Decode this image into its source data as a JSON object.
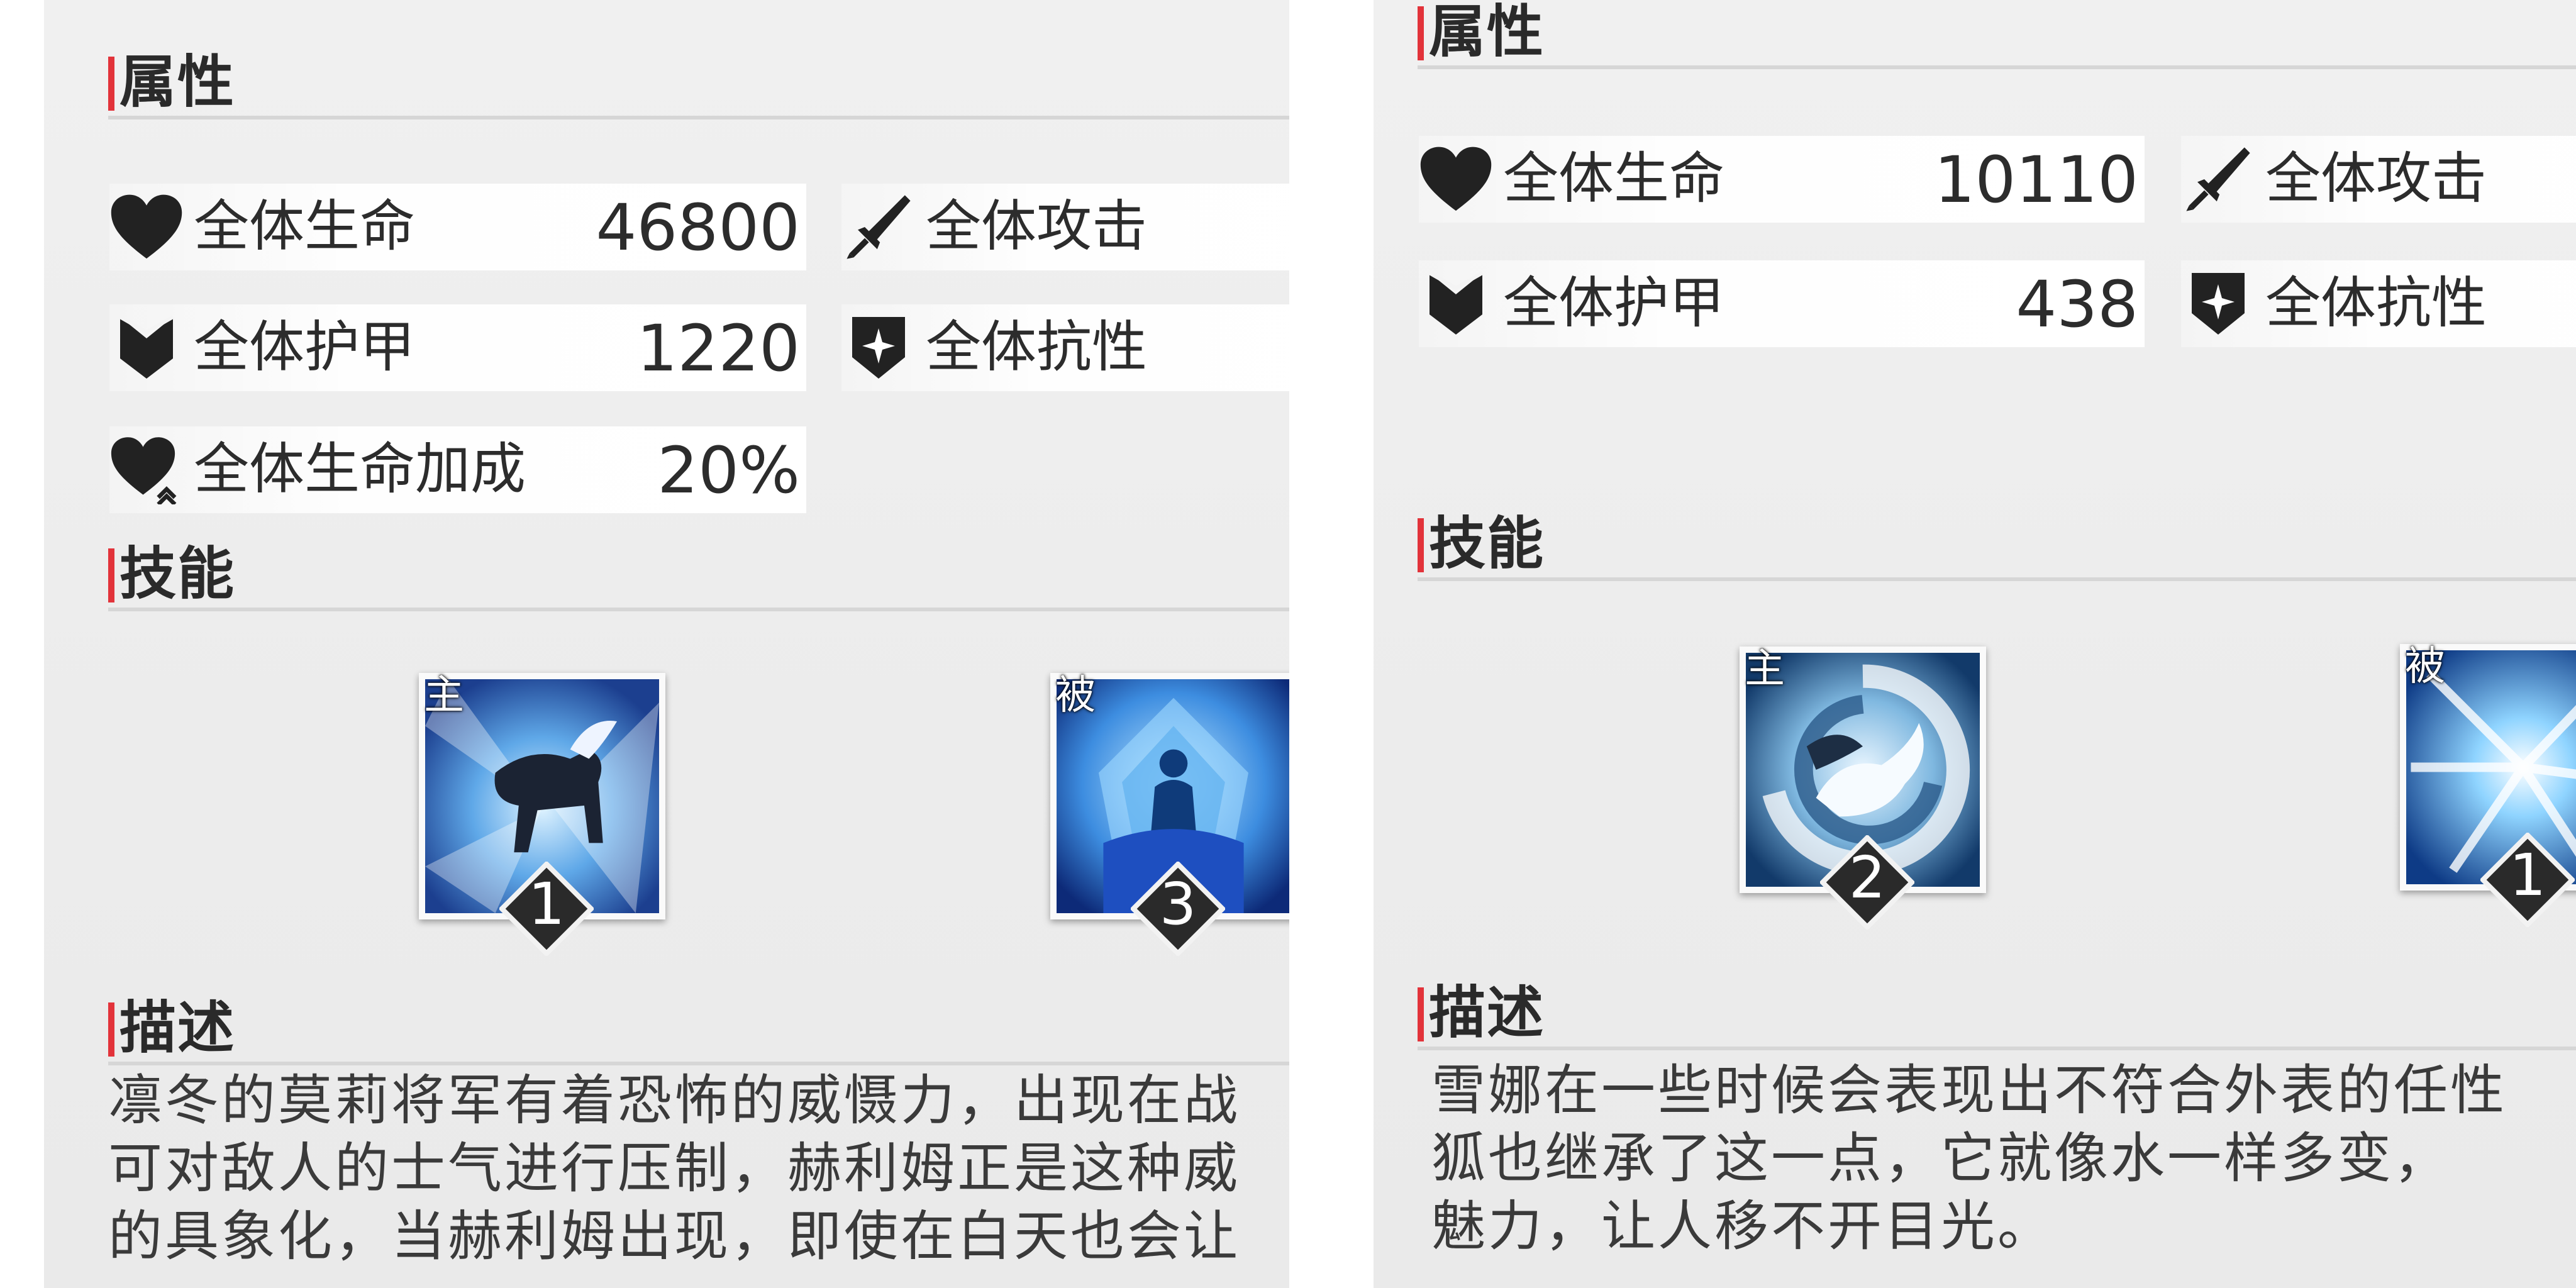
{
  "left": {
    "attributes_title": "属性",
    "stats": [
      {
        "label": "全体生命",
        "value": "46800",
        "icon": "heart-icon"
      },
      {
        "label": "全体攻击",
        "value": "",
        "icon": "sword-icon"
      },
      {
        "label": "全体护甲",
        "value": "1220",
        "icon": "armor-icon"
      },
      {
        "label": "全体抗性",
        "value": "",
        "icon": "resist-shield-icon"
      },
      {
        "label": "全体生命加成",
        "value": "20%",
        "icon": "heart-boost-icon"
      }
    ],
    "skills_title": "技能",
    "skills": [
      {
        "tag": "主",
        "level": "1",
        "icon": "ice-horse-skill-icon"
      },
      {
        "tag": "被",
        "level": "3",
        "icon": "ice-crystal-skill-icon"
      }
    ],
    "desc_title": "描述",
    "desc_lines": [
      "凛冬的莫莉将军有着恐怖的威慑力，出现在战",
      "可对敌人的士气进行压制，赫利姆正是这种威",
      "的具象化，当赫利姆出现，即使在白天也会让"
    ]
  },
  "right": {
    "attributes_title": "属性",
    "stats": [
      {
        "label": "全体生命",
        "value": "10110",
        "icon": "heart-icon"
      },
      {
        "label": "全体攻击",
        "value": "",
        "icon": "sword-icon"
      },
      {
        "label": "全体护甲",
        "value": "438",
        "icon": "armor-icon"
      },
      {
        "label": "全体抗性",
        "value": "",
        "icon": "resist-shield-icon"
      }
    ],
    "skills_title": "技能",
    "skills": [
      {
        "tag": "主",
        "level": "2",
        "icon": "snow-fox-skill-icon"
      },
      {
        "tag": "被",
        "level": "1",
        "icon": "frost-burst-skill-icon"
      }
    ],
    "desc_title": "描述",
    "desc_lines": [
      "雪娜在一些时候会表现出不符合外表的任性",
      "狐也继承了这一点，它就像水一样多变，",
      "魅力，让人移不开目光。"
    ]
  },
  "colors": {
    "accent": "#e2333a",
    "text": "#2c2c2c",
    "panel_bg": "#eeeeee"
  }
}
